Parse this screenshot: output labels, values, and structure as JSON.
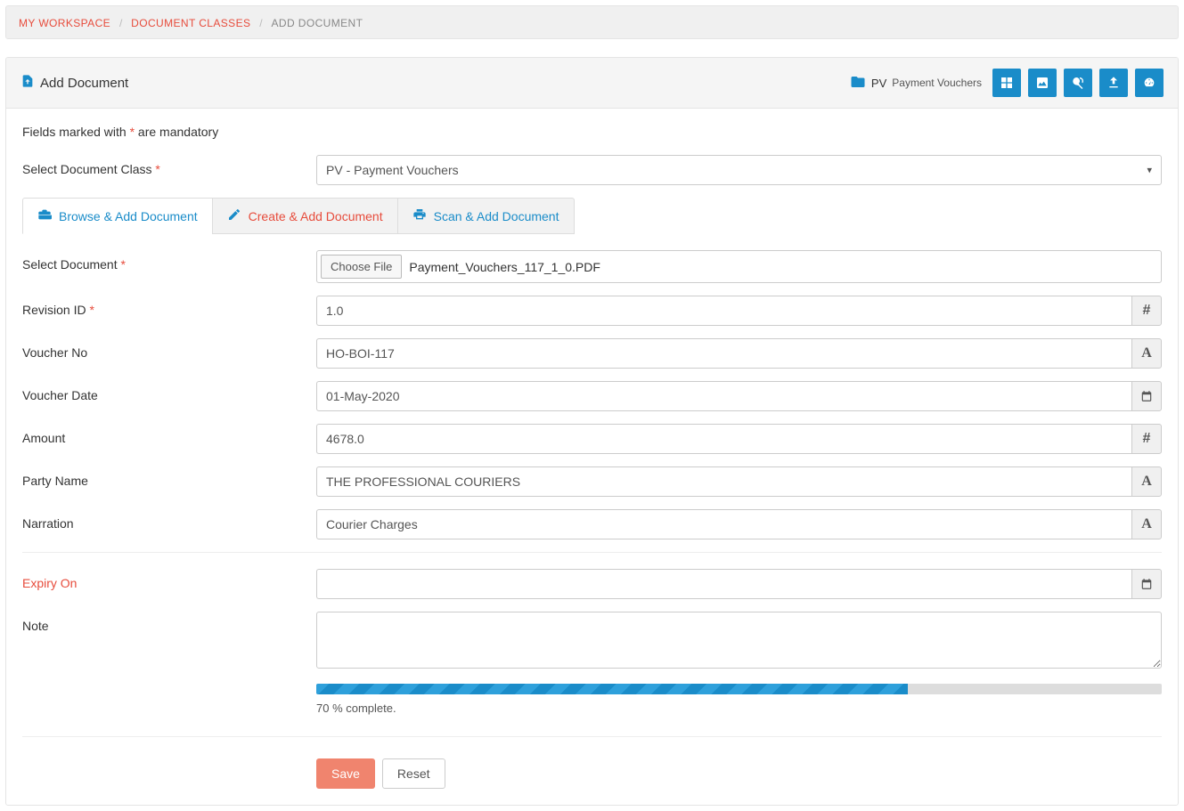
{
  "breadcrumb": {
    "items": [
      {
        "label": "MY WORKSPACE",
        "link": true
      },
      {
        "label": "DOCUMENT CLASSES",
        "link": true
      },
      {
        "label": "ADD DOCUMENT",
        "link": false
      }
    ]
  },
  "header": {
    "title": "Add Document",
    "folder_code": "PV",
    "folder_name": "Payment Vouchers"
  },
  "mandatory_text_pre": "Fields marked with ",
  "mandatory_text_post": " are mandatory",
  "asterisk": "*",
  "form": {
    "doc_class_label": "Select Document Class ",
    "doc_class_value": "PV - Payment Vouchers",
    "select_document_label": "Select Document ",
    "choose_file_label": "Choose File",
    "file_name": "Payment_Vouchers_117_1_0.PDF",
    "revision_label": "Revision ID ",
    "revision_value": "1.0",
    "voucher_no_label": "Voucher No",
    "voucher_no_value": "HO-BOI-117",
    "voucher_date_label": "Voucher Date",
    "voucher_date_value": "01-May-2020",
    "amount_label": "Amount",
    "amount_value": "4678.0",
    "party_label": "Party Name",
    "party_value": "THE PROFESSIONAL COURIERS",
    "narration_label": "Narration",
    "narration_value": "Courier Charges",
    "expiry_label": "Expiry On",
    "expiry_value": "",
    "note_label": "Note",
    "note_value": ""
  },
  "tabs": {
    "browse": "Browse & Add Document",
    "create": "Create & Add Document",
    "scan": "Scan & Add Document"
  },
  "progress": {
    "percent": 70,
    "text": "70 % complete."
  },
  "buttons": {
    "save": "Save",
    "reset": "Reset"
  }
}
